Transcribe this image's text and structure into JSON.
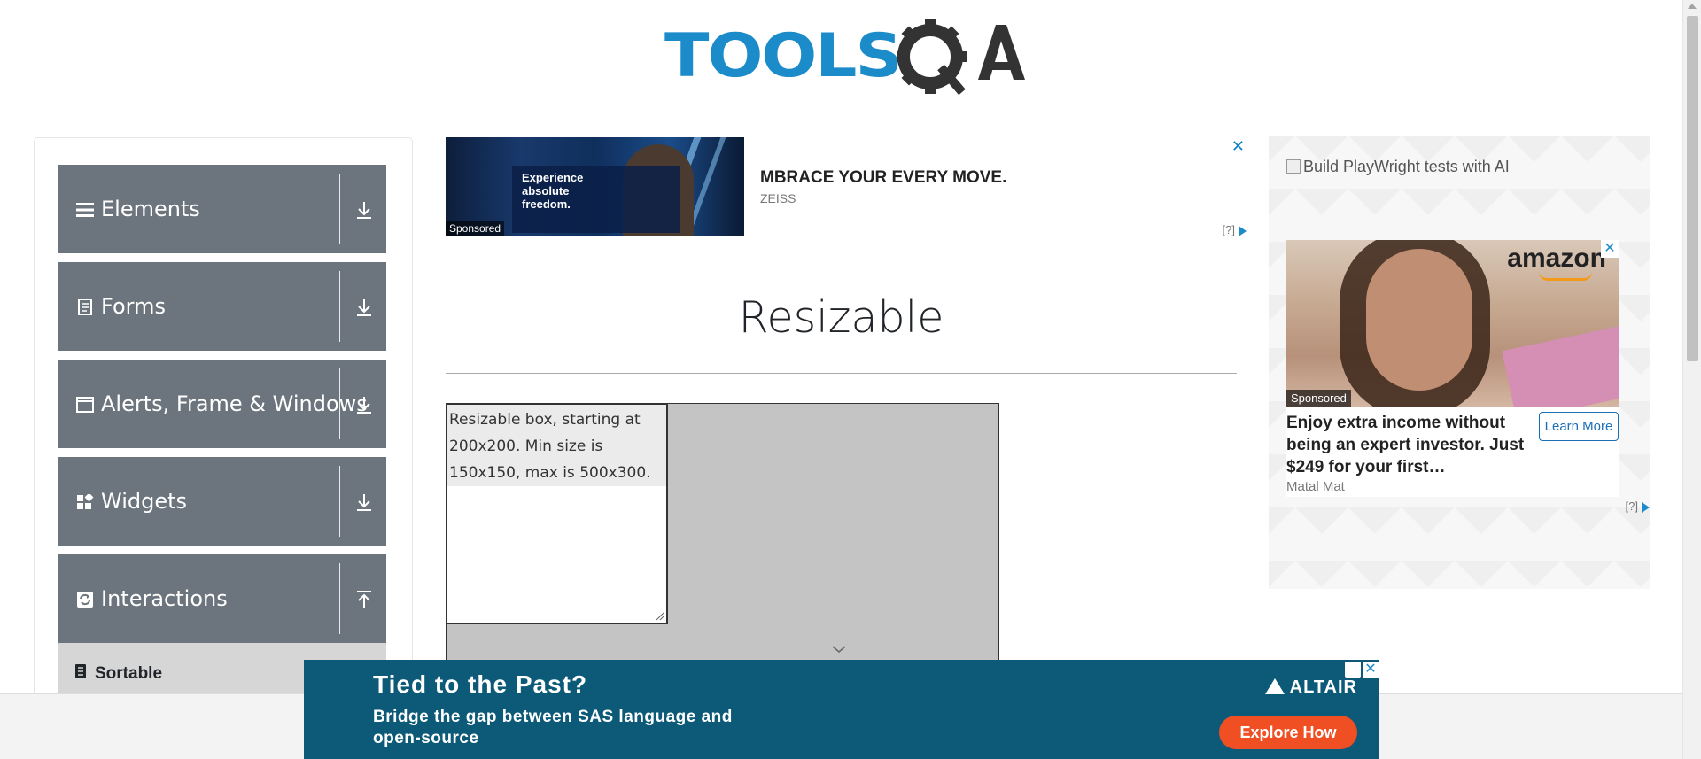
{
  "logo": {
    "text": "TOOLS",
    "suffix": "QA"
  },
  "nav": {
    "groups": [
      {
        "label": "Elements",
        "icon": "hamburger-icon",
        "state": "collapsed"
      },
      {
        "label": "Forms",
        "icon": "document-icon",
        "state": "collapsed"
      },
      {
        "label": "Alerts, Frame & Windows",
        "icon": "window-icon",
        "state": "collapsed"
      },
      {
        "label": "Widgets",
        "icon": "widgets-icon",
        "state": "collapsed"
      },
      {
        "label": "Interactions",
        "icon": "refresh-icon",
        "state": "expanded"
      }
    ],
    "subitem": {
      "label": "Sortable",
      "icon": "book-icon"
    }
  },
  "top_ad": {
    "headline": "MBRACE YOUR EVERY MOVE.",
    "brand": "ZEISS",
    "image_title": "Experience absolute freedom.",
    "sponsored": "Sponsored",
    "close": "✕",
    "adchoice": "[?]"
  },
  "page": {
    "title": "Resizable"
  },
  "resizable": {
    "text": "Resizable box, starting at 200x200. Min size is 150x150, max is 500x300."
  },
  "right_ad": {
    "broken_image_alt": "Build PlayWright tests with AI",
    "brand": "amazon",
    "sponsored": "Sponsored",
    "headline": "Enjoy extra income without being an expert investor. Just $249 for your first…",
    "button": "Learn More",
    "advertiser": "Matal Mat",
    "adchoice": "[?]",
    "close": "✕"
  },
  "bottom_ad": {
    "title": "Tied to the Past?",
    "body": "Bridge the gap between SAS language and open-source",
    "brand": "ALTAIR",
    "cta": "Explore How",
    "close": "✕"
  }
}
